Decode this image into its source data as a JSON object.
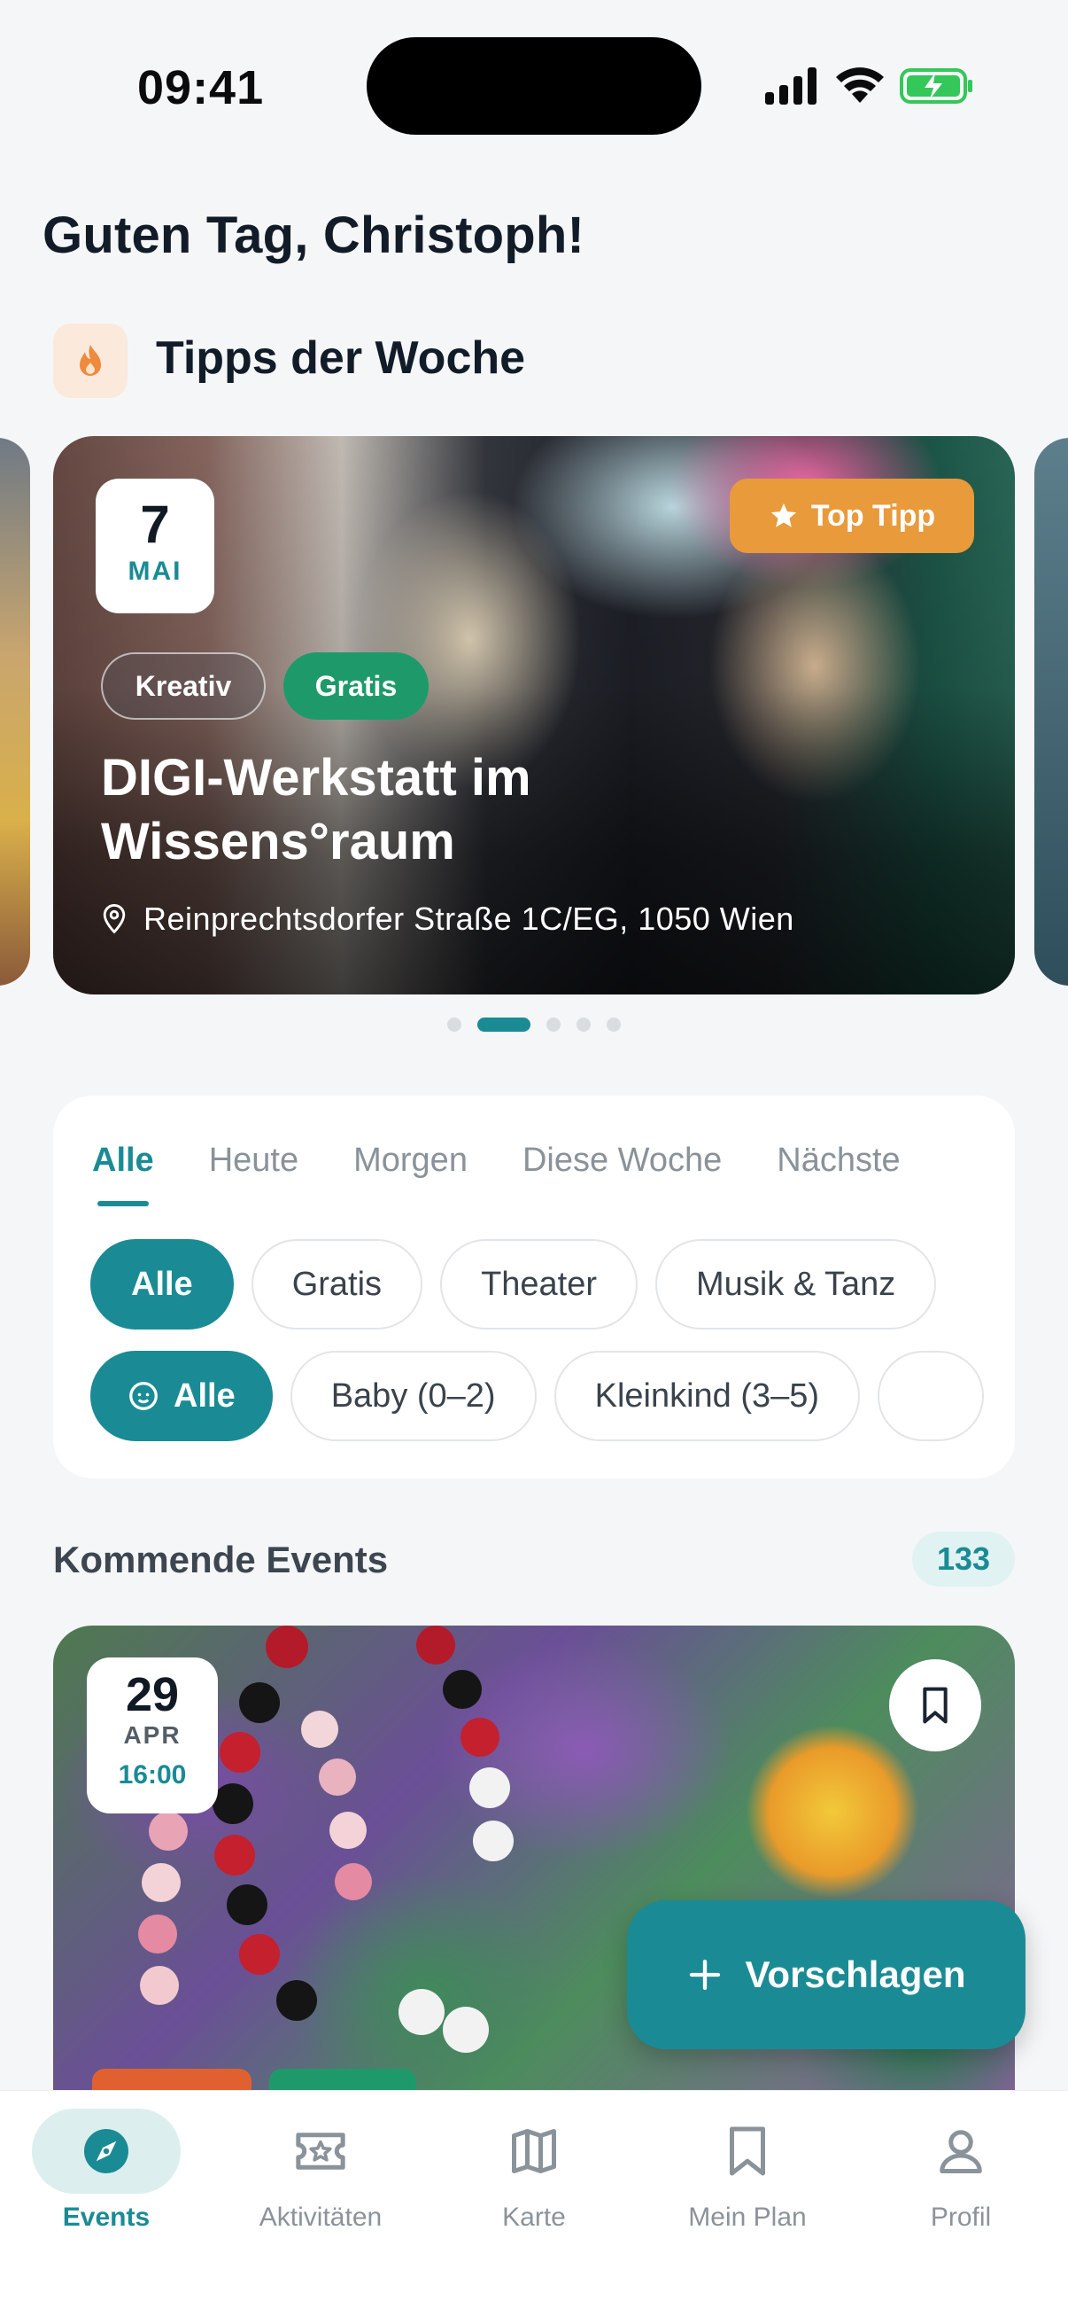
{
  "status_bar": {
    "time": "09:41"
  },
  "greeting": "Guten Tag, Christoph!",
  "tips": {
    "title": "Tipps der Woche",
    "featured": {
      "day": "7",
      "month": "MAI",
      "badge": "Top Tipp",
      "tags": [
        "Kreativ",
        "Gratis"
      ],
      "title": "DIGI-Werkstatt im Wissens°raum",
      "location": "Reinprechtsdorfer Straße 1C/EG, 1050 Wien"
    },
    "pages": 5,
    "active_page": 2
  },
  "filters": {
    "date_tabs": [
      "Alle",
      "Heute",
      "Morgen",
      "Diese Woche",
      "Nächste"
    ],
    "active_tab": "Alle",
    "categories": [
      "Alle",
      "Gratis",
      "Theater",
      "Musik & Tanz"
    ],
    "age_groups": [
      "Alle",
      "Baby (0–2)",
      "Kleinkind (3–5)"
    ]
  },
  "upcoming": {
    "title": "Kommende Events",
    "count": "133",
    "first_event": {
      "day": "29",
      "month": "APR",
      "time": "16:00"
    }
  },
  "fab": {
    "label": "Vorschlagen"
  },
  "nav": [
    {
      "label": "Events",
      "icon": "compass-icon"
    },
    {
      "label": "Aktivitäten",
      "icon": "ticket-icon"
    },
    {
      "label": "Karte",
      "icon": "map-icon"
    },
    {
      "label": "Mein Plan",
      "icon": "bookmark-icon"
    },
    {
      "label": "Profil",
      "icon": "user-icon"
    }
  ],
  "colors": {
    "accent": "#1a8b95",
    "top_tipp": "#e99a3b",
    "gratis": "#1e9a6a"
  }
}
